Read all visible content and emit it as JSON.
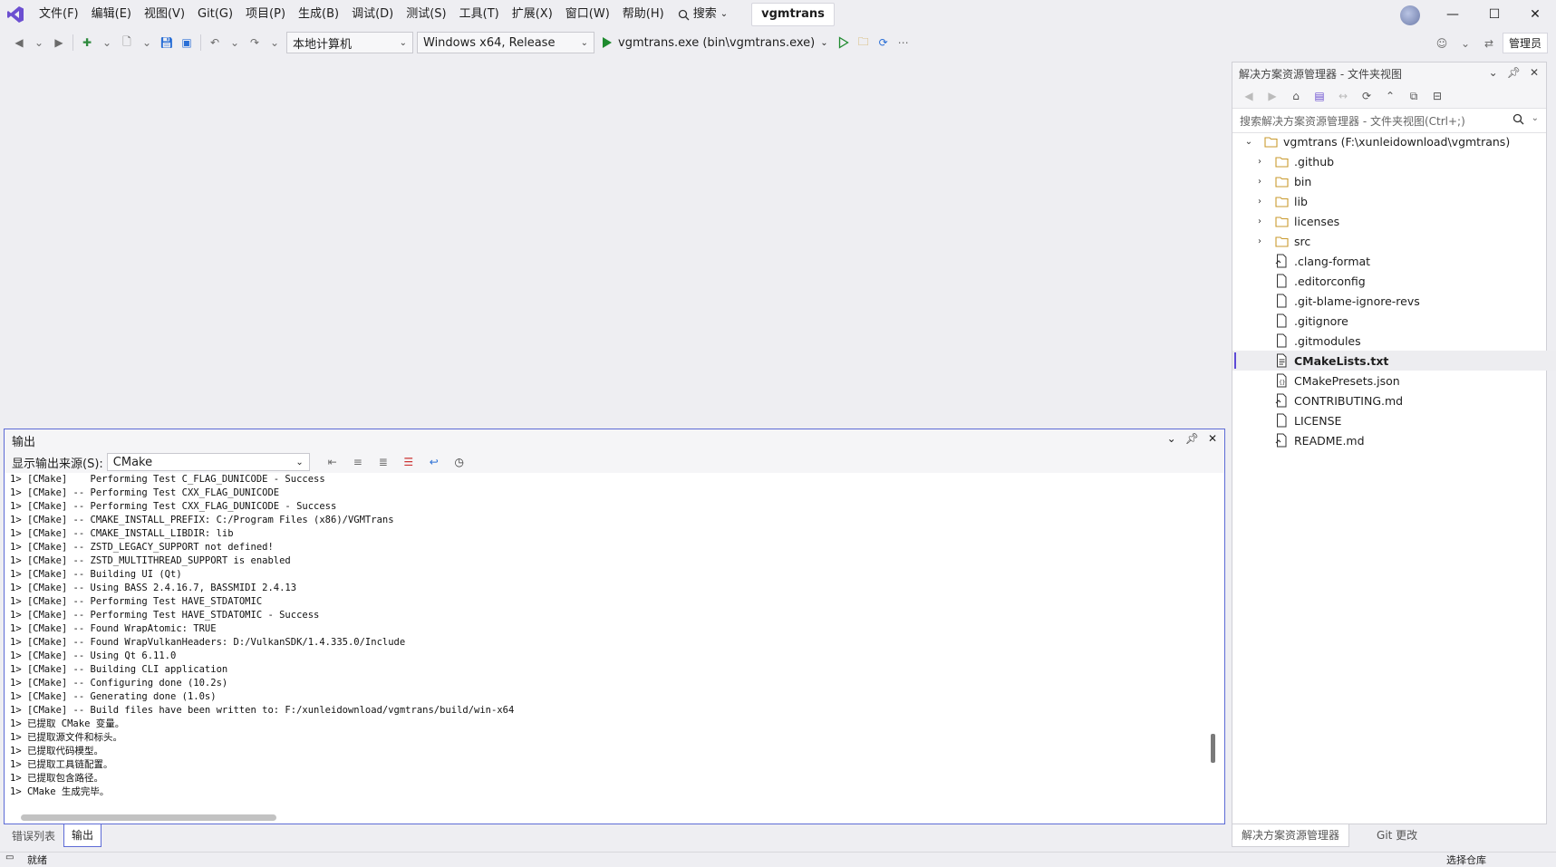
{
  "menu": {
    "items": [
      "文件(F)",
      "编辑(E)",
      "视图(V)",
      "Git(G)",
      "项目(P)",
      "生成(B)",
      "调试(D)",
      "测试(S)",
      "工具(T)",
      "扩展(X)",
      "窗口(W)",
      "帮助(H)"
    ],
    "search_label": "搜索",
    "solution_name": "vgmtrans"
  },
  "toolbar": {
    "target_machine": "本地计算机",
    "configuration": "Windows x64, Release",
    "startup_item": "vgmtrans.exe (bin\\vgmtrans.exe)",
    "admin_label": "管理员"
  },
  "output_panel": {
    "title": "输出",
    "source_label": "显示输出来源(S):",
    "source_value": "CMake",
    "lines": [
      "1> [CMake]    Performing Test C_FLAG_DUNICODE - Success",
      "1> [CMake] -- Performing Test CXX_FLAG_DUNICODE",
      "1> [CMake] -- Performing Test CXX_FLAG_DUNICODE - Success",
      "1> [CMake] -- CMAKE_INSTALL_PREFIX: C:/Program Files (x86)/VGMTrans",
      "1> [CMake] -- CMAKE_INSTALL_LIBDIR: lib",
      "1> [CMake] -- ZSTD_LEGACY_SUPPORT not defined!",
      "1> [CMake] -- ZSTD_MULTITHREAD_SUPPORT is enabled",
      "1> [CMake] -- Building UI (Qt)",
      "1> [CMake] -- Using BASS 2.4.16.7, BASSMIDI 2.4.13",
      "1> [CMake] -- Performing Test HAVE_STDATOMIC",
      "1> [CMake] -- Performing Test HAVE_STDATOMIC - Success",
      "1> [CMake] -- Found WrapAtomic: TRUE",
      "1> [CMake] -- Found WrapVulkanHeaders: D:/VulkanSDK/1.4.335.0/Include",
      "1> [CMake] -- Using Qt 6.11.0",
      "1> [CMake] -- Building CLI application",
      "1> [CMake] -- Configuring done (10.2s)",
      "1> [CMake] -- Generating done (1.0s)",
      "1> [CMake] -- Build files have been written to: F:/xunleidownload/vgmtrans/build/win-x64",
      "1> 已提取 CMake 变量。",
      "1> 已提取源文件和标头。",
      "1> 已提取代码模型。",
      "1> 已提取工具链配置。",
      "1> 已提取包含路径。",
      "1> CMake 生成完毕。"
    ]
  },
  "bottom_tabs": [
    "错误列表",
    "输出"
  ],
  "solution_explorer": {
    "title": "解决方案资源管理器 - 文件夹视图",
    "search_placeholder": "搜索解决方案资源管理器 - 文件夹视图(Ctrl+;)",
    "root": "vgmtrans (F:\\xunleidownload\\vgmtrans)",
    "folders": [
      ".github",
      "bin",
      "lib",
      "licenses",
      "src"
    ],
    "files": [
      {
        "name": ".clang-format",
        "icon": "config-file-icon"
      },
      {
        "name": ".editorconfig",
        "icon": "file-icon"
      },
      {
        "name": ".git-blame-ignore-revs",
        "icon": "file-icon"
      },
      {
        "name": ".gitignore",
        "icon": "file-icon"
      },
      {
        "name": ".gitmodules",
        "icon": "file-icon"
      },
      {
        "name": "CMakeLists.txt",
        "icon": "text-file-icon",
        "selected": true
      },
      {
        "name": "CMakePresets.json",
        "icon": "json-file-icon"
      },
      {
        "name": "CONTRIBUTING.md",
        "icon": "markdown-file-icon"
      },
      {
        "name": "LICENSE",
        "icon": "file-icon"
      },
      {
        "name": "README.md",
        "icon": "markdown-file-icon"
      }
    ],
    "tabs": [
      "解决方案资源管理器",
      "Git 更改"
    ]
  },
  "status": {
    "left": "就绪",
    "right": "选择仓库"
  },
  "colors": {
    "accent": "#5d6bd6",
    "run_green": "#1e8a2e",
    "folder": "#c99a2e",
    "chrome_bg": "#eeeef2"
  }
}
